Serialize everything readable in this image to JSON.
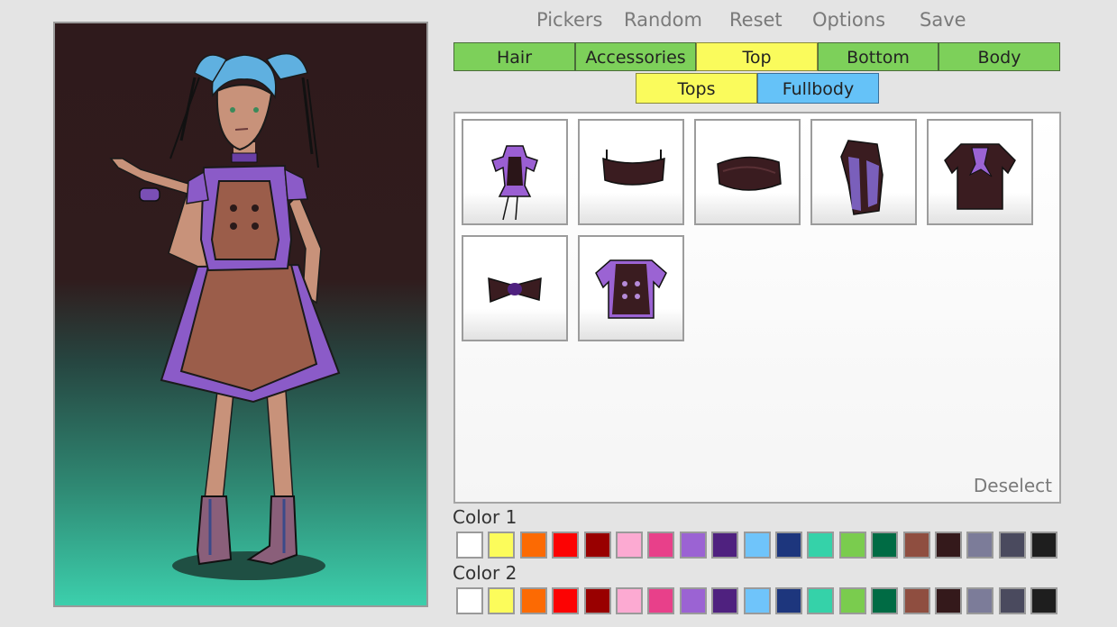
{
  "menu": [
    "Pickers",
    "Random",
    "Reset",
    "Options",
    "Save"
  ],
  "category_tabs": [
    {
      "label": "Hair",
      "state": "inactive"
    },
    {
      "label": "Accessories",
      "state": "inactive"
    },
    {
      "label": "Top",
      "state": "active"
    },
    {
      "label": "Bottom",
      "state": "inactive"
    },
    {
      "label": "Body",
      "state": "inactive"
    }
  ],
  "sub_tabs": [
    {
      "label": "Tops",
      "state": "inactive"
    },
    {
      "label": "Fullbody",
      "state": "active"
    }
  ],
  "items": [
    {
      "name": "corset-dress-item"
    },
    {
      "name": "bandeau-bra-item"
    },
    {
      "name": "wrapped-tube-top-item"
    },
    {
      "name": "draped-shawl-item"
    },
    {
      "name": "scarf-blouse-item"
    },
    {
      "name": "bow-top-item"
    },
    {
      "name": "pinafore-vest-item"
    }
  ],
  "deselect_label": "Deselect",
  "color1_label": "Color 1",
  "color2_label": "Color 2",
  "colors": [
    "#ffffff",
    "#fcfc5b",
    "#fc6a03",
    "#fc0303",
    "#990000",
    "#fcaad2",
    "#e8408a",
    "#9b63d3",
    "#4f217f",
    "#6fc4fa",
    "#1d367d",
    "#35d2a9",
    "#7acc4e",
    "#006b44",
    "#8f4e40",
    "#34191b",
    "#7c7c99",
    "#4a4a5e",
    "#1e1e1e"
  ],
  "theme": {
    "tab_green": "#7dd05a",
    "tab_yellow": "#fafb5c",
    "tab_blue": "#65c2f8"
  }
}
